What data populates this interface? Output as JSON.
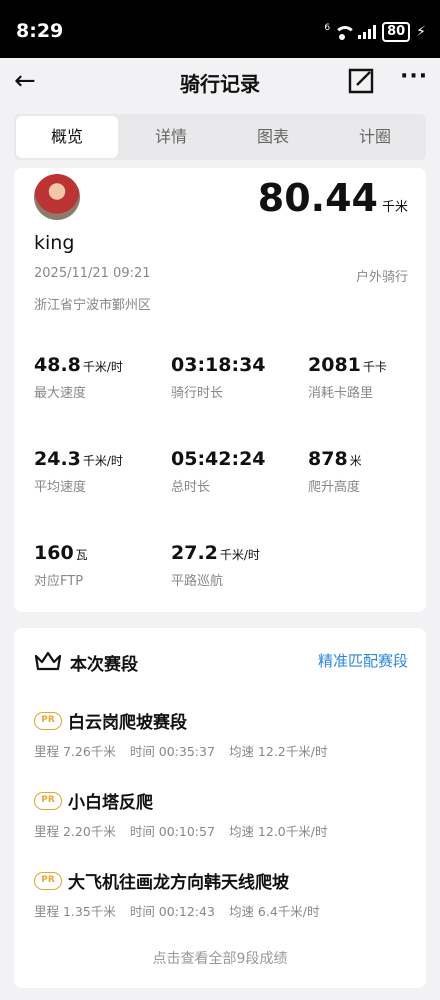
{
  "status_bar": {
    "time": "8:29",
    "network": "6",
    "battery": "80"
  },
  "header": {
    "back_icon": "←",
    "title": "骑行记录",
    "more_icon": "···"
  },
  "tabs": [
    {
      "label": "概览",
      "active": true
    },
    {
      "label": "详情",
      "active": false
    },
    {
      "label": "图表",
      "active": false
    },
    {
      "label": "计圈",
      "active": false
    }
  ],
  "summary": {
    "distance": "80.44",
    "distance_unit": "千米",
    "username": "king",
    "datetime": "2025/11/21 09:21",
    "ride_type": "户外骑行",
    "location": "浙江省宁波市鄞州区"
  },
  "stats": [
    {
      "value": "48.8",
      "unit": "千米/时",
      "label": "最大速度"
    },
    {
      "value": "03:18:34",
      "unit": "",
      "label": "骑行时长"
    },
    {
      "value": "2081",
      "unit": "千卡",
      "label": "消耗卡路里"
    },
    {
      "value": "24.3",
      "unit": "千米/时",
      "label": "平均速度"
    },
    {
      "value": "05:42:24",
      "unit": "",
      "label": "总时长"
    },
    {
      "value": "878",
      "unit": "米",
      "label": "爬升高度"
    },
    {
      "value": "160",
      "unit": "瓦",
      "label": "对应FTP"
    },
    {
      "value": "27.2",
      "unit": "千米/时",
      "label": "平路巡航"
    }
  ],
  "segments_section": {
    "title": "本次赛段",
    "match_link": "精准匹配赛段",
    "pr_label": "PR",
    "items": [
      {
        "name": "白云岗爬坡赛段",
        "distance": "里程 7.26千米",
        "time": "时间 00:35:37",
        "speed": "均速 12.2千米/时"
      },
      {
        "name": "小白塔反爬",
        "distance": "里程 2.20千米",
        "time": "时间 00:10:57",
        "speed": "均速 12.0千米/时"
      },
      {
        "name": "大飞机往画龙方向韩天线爬坡",
        "distance": "里程 1.35千米",
        "time": "时间 00:12:43",
        "speed": "均速 6.4千米/时"
      }
    ],
    "view_all": "点击查看全部9段成绩"
  },
  "colors": {
    "accent": "#2e86de",
    "pr_badge": "#e6a532"
  }
}
